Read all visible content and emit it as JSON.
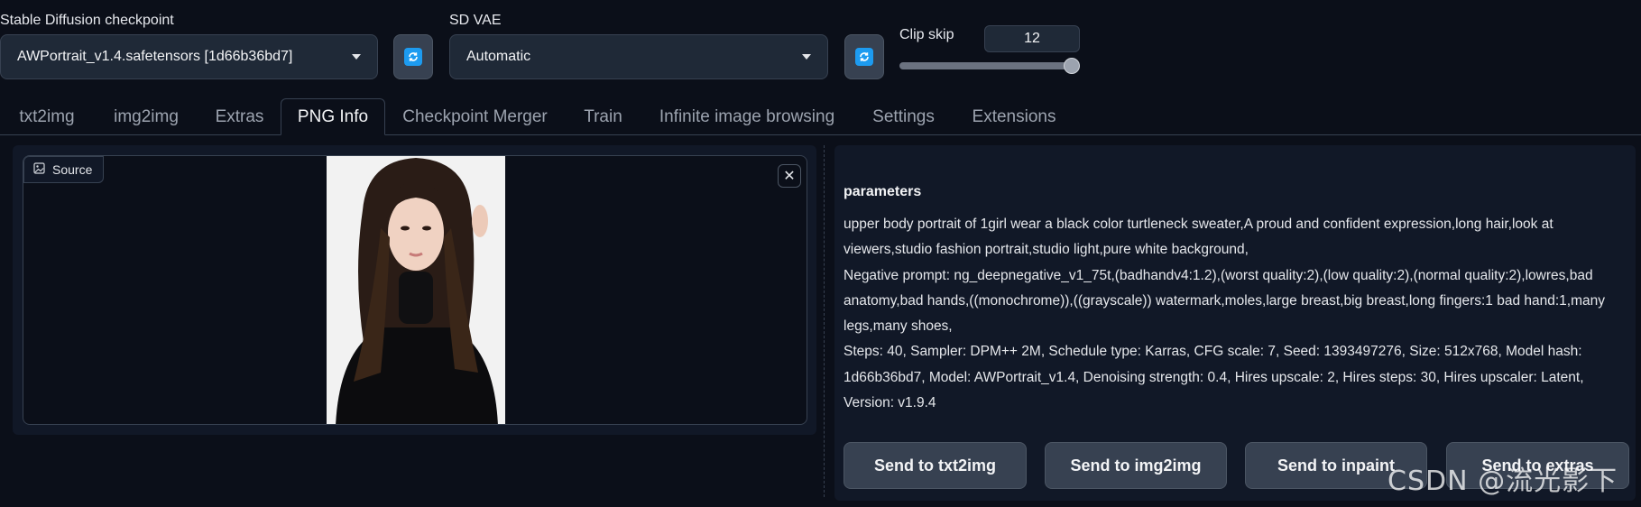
{
  "top": {
    "checkpoint": {
      "label": "Stable Diffusion checkpoint",
      "value": "AWPortrait_v1.4.safetensors [1d66b36bd7]"
    },
    "vae": {
      "label": "SD VAE",
      "value": "Automatic"
    },
    "clip_skip": {
      "label": "Clip skip",
      "value": "12",
      "slider_fraction": 1.0
    }
  },
  "tabs": [
    {
      "label": "txt2img",
      "active": false
    },
    {
      "label": "img2img",
      "active": false
    },
    {
      "label": "Extras",
      "active": false
    },
    {
      "label": "PNG Info",
      "active": true
    },
    {
      "label": "Checkpoint Merger",
      "active": false
    },
    {
      "label": "Train",
      "active": false
    },
    {
      "label": "Infinite image browsing",
      "active": false
    },
    {
      "label": "Settings",
      "active": false
    },
    {
      "label": "Extensions",
      "active": false
    }
  ],
  "source": {
    "label": "Source",
    "close_glyph": "✕"
  },
  "params": {
    "title": "parameters",
    "text": "upper body portrait of 1girl wear a black color turtleneck sweater,A proud and confident expression,long hair,look at viewers,studio fashion portrait,studio light,pure white background,\nNegative prompt: ng_deepnegative_v1_75t,(badhandv4:1.2),(worst quality:2),(low quality:2),(normal quality:2),lowres,bad anatomy,bad hands,((monochrome)),((grayscale)) watermark,moles,large breast,big breast,long fingers:1 bad hand:1,many legs,many shoes,\nSteps: 40, Sampler: DPM++ 2M, Schedule type: Karras, CFG scale: 7, Seed: 1393497276, Size: 512x768, Model hash: 1d66b36bd7, Model: AWPortrait_v1.4, Denoising strength: 0.4, Hires upscale: 2, Hires steps: 30, Hires upscaler: Latent, Version: v1.9.4"
  },
  "buttons": {
    "txt2img": "Send to txt2img",
    "img2img": "Send to img2img",
    "inpaint": "Send to inpaint",
    "extras": "Send to extras"
  },
  "watermark": "CSDN @流光影下",
  "colors": {
    "background": "#0b0f19",
    "panel": "#111827",
    "accent": "#1d9bf0"
  },
  "icons": {
    "refresh": "refresh-icon",
    "image": "image-icon",
    "close": "close-icon",
    "dropdown": "chevron-down-icon"
  }
}
